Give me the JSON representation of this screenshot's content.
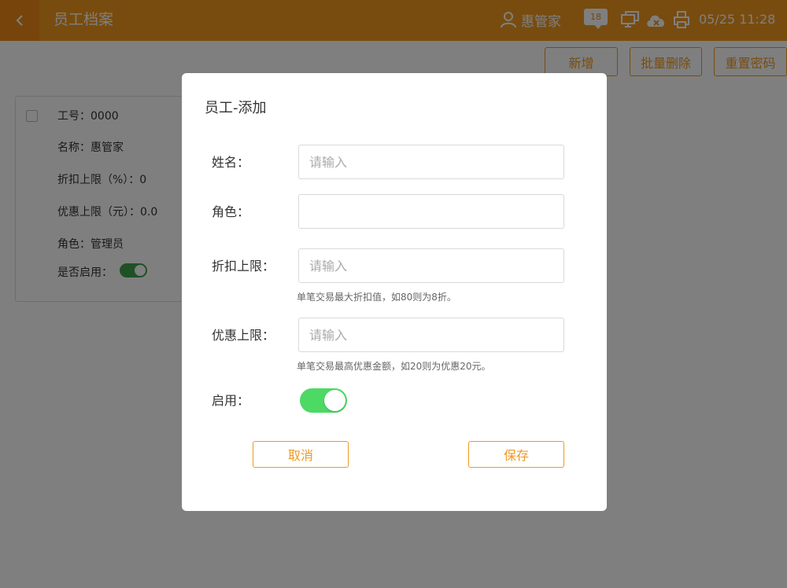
{
  "header": {
    "title": "员工档案",
    "user_name": "惠管家",
    "message_count": "18",
    "datetime": "05/25 11:28",
    "icons": [
      "back-icon",
      "user-icon",
      "message-icon",
      "monitor-icon",
      "cloud-sync-icon",
      "printer-icon"
    ]
  },
  "toolbar": {
    "add_label": "新增",
    "batch_delete_label": "批量删除",
    "reset_password_label": "重置密码"
  },
  "card": {
    "emp_no": "工号：0000",
    "name": "名称：惠管家",
    "discount_limit": "折扣上限（%）：0",
    "offer_limit": "优惠上限（元）：0.0",
    "role": "角色：管理员",
    "enabled_label": "是否启用：",
    "enabled": true
  },
  "modal": {
    "title": "员工-添加",
    "name_label": "姓名：",
    "name_placeholder": "请输入",
    "role_label": "角色：",
    "role_value": "",
    "discount_label": "折扣上限：",
    "discount_placeholder": "请输入",
    "discount_hint": "单笔交易最大折扣值，如80则为8折。",
    "offer_label": "优惠上限：",
    "offer_placeholder": "请输入",
    "offer_hint": "单笔交易最高优惠金额，如20则为优惠20元。",
    "enable_label": "启用：",
    "enabled": true,
    "cancel_label": "取消",
    "save_label": "保存"
  },
  "colors": {
    "brand": "#f0981f",
    "toggle_on": "#4cd964",
    "card_toggle_on": "#3fa34d"
  }
}
